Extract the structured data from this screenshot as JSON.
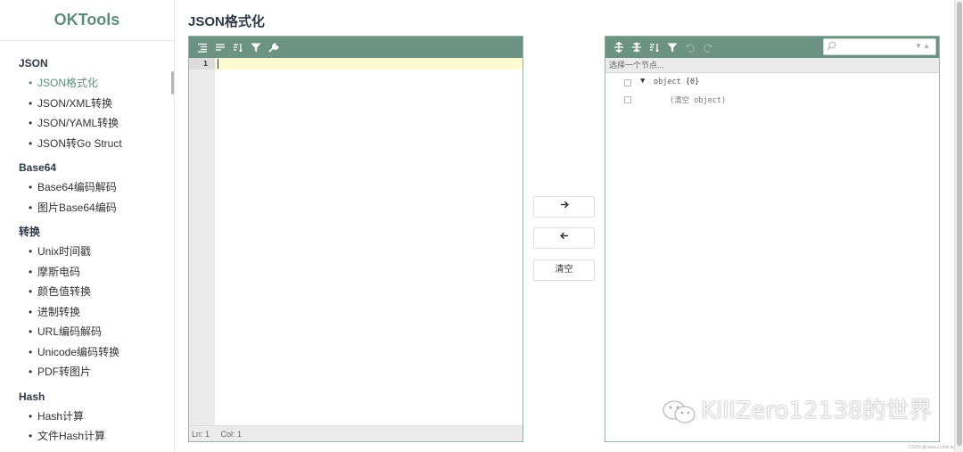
{
  "brand": "OKTools",
  "sidebar": {
    "groups": [
      {
        "title": "JSON",
        "items": [
          {
            "label": "JSON格式化",
            "active": true
          },
          {
            "label": "JSON/XML转换"
          },
          {
            "label": "JSON/YAML转换"
          },
          {
            "label": "JSON转Go Struct"
          }
        ]
      },
      {
        "title": "Base64",
        "items": [
          {
            "label": "Base64编码解码"
          },
          {
            "label": "图片Base64编码"
          }
        ]
      },
      {
        "title": "转换",
        "items": [
          {
            "label": "Unix时间戳"
          },
          {
            "label": "摩斯电码"
          },
          {
            "label": "颜色值转换"
          },
          {
            "label": "进制转换"
          },
          {
            "label": "URL编码解码"
          },
          {
            "label": "Unicode编码转换"
          },
          {
            "label": "PDF转图片"
          }
        ]
      },
      {
        "title": "Hash",
        "items": [
          {
            "label": "Hash计算"
          },
          {
            "label": "文件Hash计算"
          }
        ]
      }
    ],
    "bullet": "•"
  },
  "page": {
    "title": "JSON格式化"
  },
  "left_editor": {
    "toolbar_icons": [
      "format-icon",
      "compact-icon",
      "sort-icon",
      "filter-icon",
      "repair-icon"
    ],
    "line_number": "1",
    "status": {
      "ln": "Ln: 1",
      "col": "Col: 1"
    }
  },
  "middle": {
    "to_right_label": "→",
    "to_left_label": "←",
    "clear_label": "清空"
  },
  "right_editor": {
    "toolbar_icons": [
      "expand-all-icon",
      "collapse-all-icon",
      "sort-icon",
      "filter-icon",
      "undo-icon",
      "redo-icon"
    ],
    "search_placeholder": "",
    "nav_hint": "选择一个节点...",
    "root": {
      "type": "object",
      "count": "{0}"
    },
    "empty_hint": "(清空 object)"
  },
  "watermark": "KillZero1213​8的世界",
  "credit": "CSDN @Java∠Unix bug",
  "colors": {
    "accent": "#5e8c7c",
    "toolbar": "#6b9282",
    "active_line": "#fffbd1"
  }
}
